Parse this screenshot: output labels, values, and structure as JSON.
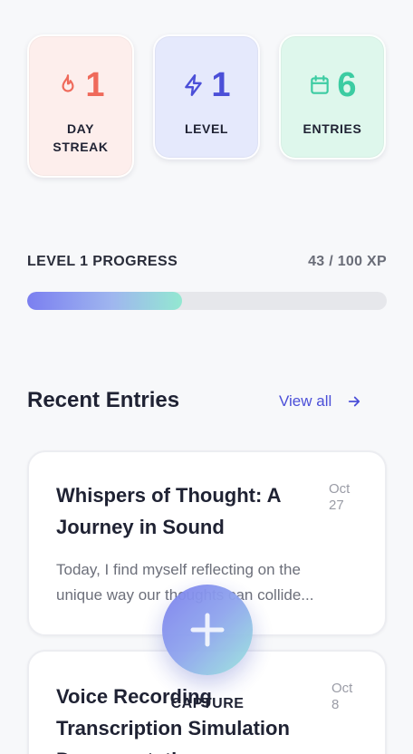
{
  "stats": [
    {
      "value": "1",
      "label": "DAY STREAK",
      "icon": "flame-icon",
      "color": "#ef6a5b"
    },
    {
      "value": "1",
      "label": "LEVEL",
      "icon": "lightning-icon",
      "color": "#4b4fd8"
    },
    {
      "value": "6",
      "label": "ENTRIES",
      "icon": "calendar-icon",
      "color": "#3ccca2"
    }
  ],
  "progress": {
    "title": "LEVEL 1 PROGRESS",
    "xp_text": "43 / 100 XP",
    "fraction": 0.43
  },
  "recent": {
    "title": "Recent Entries",
    "view_all_label": "View all"
  },
  "entries": [
    {
      "title": "Whispers of Thought: A Journey in Sound",
      "date_month": "Oct",
      "date_day": "27",
      "excerpt_line1": "Today, I find myself reflecting on the",
      "excerpt_line2": "unique way our thoughts can collide..."
    },
    {
      "title": "Voice Recording Transcription Simulation Documentation",
      "date_month": "Oct",
      "date_day": "8"
    }
  ],
  "fab": {
    "label": "CAPTURE",
    "icon": "plus-icon"
  },
  "colors": {
    "accent": "#4b4fd8",
    "streak": "#ef6a5b",
    "entries": "#3ccca2"
  }
}
